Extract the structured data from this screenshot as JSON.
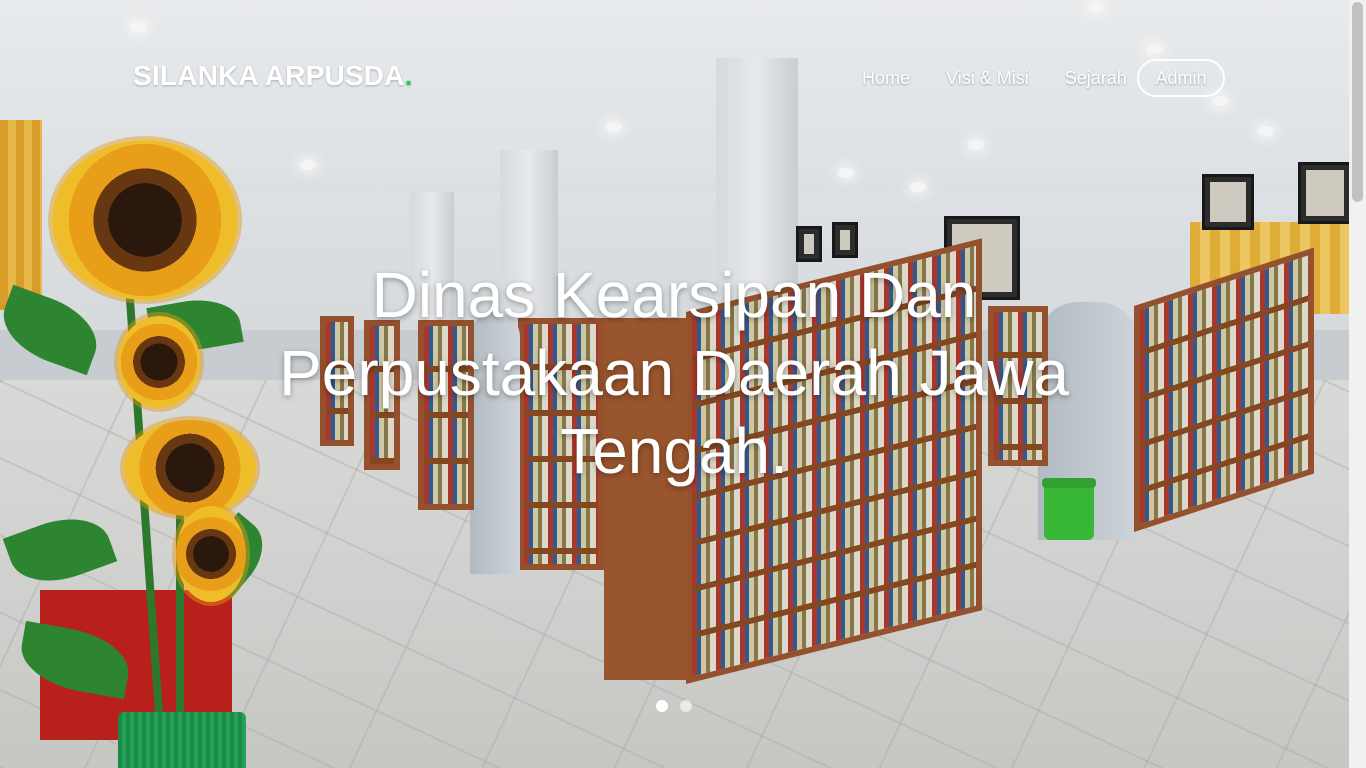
{
  "brand": {
    "name": "SILANKA ARPUSDA",
    "dot": "."
  },
  "nav": {
    "items": [
      {
        "label": "Home"
      },
      {
        "label": "Visi & Misi"
      },
      {
        "label": "Sejarah"
      }
    ],
    "admin_label": "Admin"
  },
  "hero": {
    "title": "Dinas Kearsipan Dan Perpustakaan Daerah Jawa Tengah."
  },
  "carousel": {
    "slides": 2,
    "active_index": 0
  },
  "colors": {
    "brand_dot": "#2ecc40",
    "text": "#ffffff"
  }
}
